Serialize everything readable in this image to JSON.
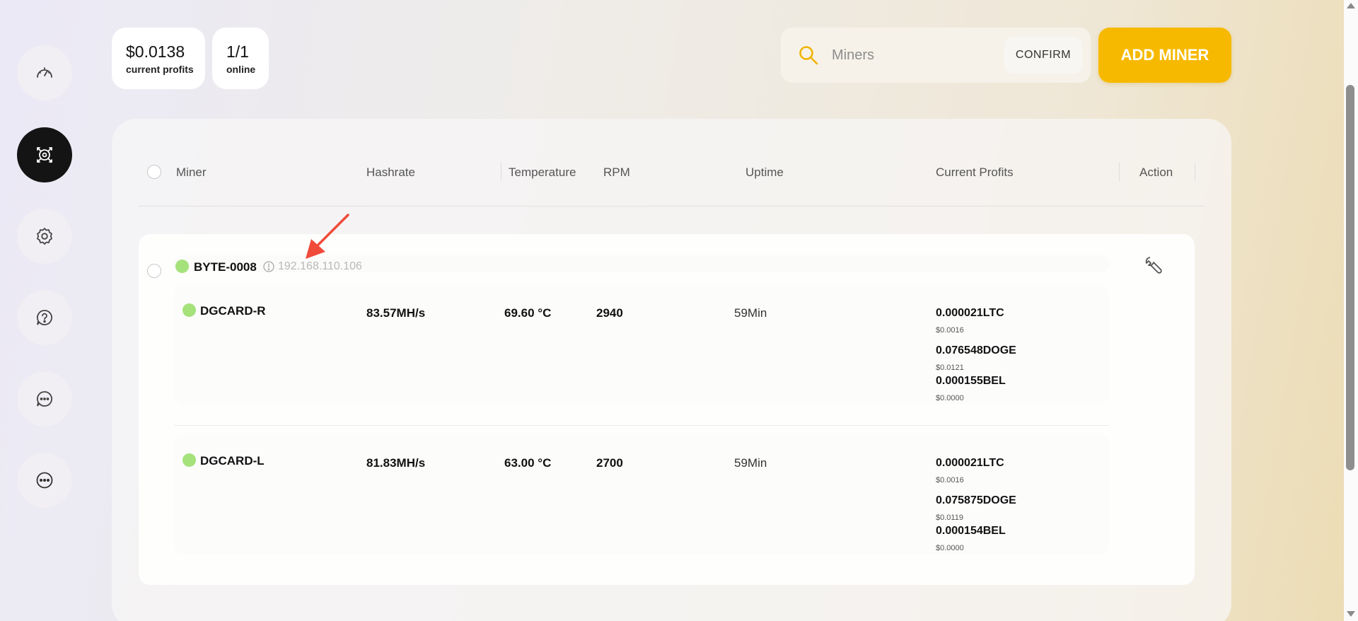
{
  "stats": [
    {
      "value": "$0.0138",
      "label": "current profits"
    },
    {
      "value": "1/1",
      "label": "online"
    }
  ],
  "search": {
    "placeholder": "Miners",
    "value": "",
    "confirm_label": "CONFIRM"
  },
  "add_button_label": "ADD MINER",
  "sidebar": {
    "items": [
      {
        "icon": "speedometer-icon"
      },
      {
        "icon": "miner-chip-icon",
        "active": true
      },
      {
        "icon": "gear-icon"
      },
      {
        "icon": "help-chat-icon"
      },
      {
        "icon": "chat-icon"
      },
      {
        "icon": "more-icon"
      }
    ]
  },
  "table": {
    "headers": [
      "Miner",
      "Hashrate",
      "Temperature",
      "RPM",
      "Uptime",
      "Current Profits",
      "Action"
    ]
  },
  "group": {
    "name": "BYTE-0008",
    "ip": "192.168.110.106",
    "status_color": "#a5e27b",
    "devices": [
      {
        "name": "DGCARD-R",
        "hashrate": "83.57MH/s",
        "temperature": "69.60 °C",
        "rpm": "2940",
        "uptime": "59Min",
        "profits": [
          {
            "amount": "0.000021LTC",
            "usd": "$0.0016"
          },
          {
            "amount": "0.076548DOGE",
            "usd": "$0.0121"
          },
          {
            "amount": "0.000155BEL",
            "usd": "$0.0000"
          }
        ]
      },
      {
        "name": "DGCARD-L",
        "hashrate": "81.83MH/s",
        "temperature": "63.00 °C",
        "rpm": "2700",
        "uptime": "59Min",
        "profits": [
          {
            "amount": "0.000021LTC",
            "usd": "$0.0016"
          },
          {
            "amount": "0.075875DOGE",
            "usd": "$0.0119"
          },
          {
            "amount": "0.000154BEL",
            "usd": "$0.0000"
          }
        ]
      }
    ]
  },
  "colors": {
    "accent": "#f7b900",
    "status_online": "#a5e27b",
    "annotation": "#f04a3a"
  }
}
